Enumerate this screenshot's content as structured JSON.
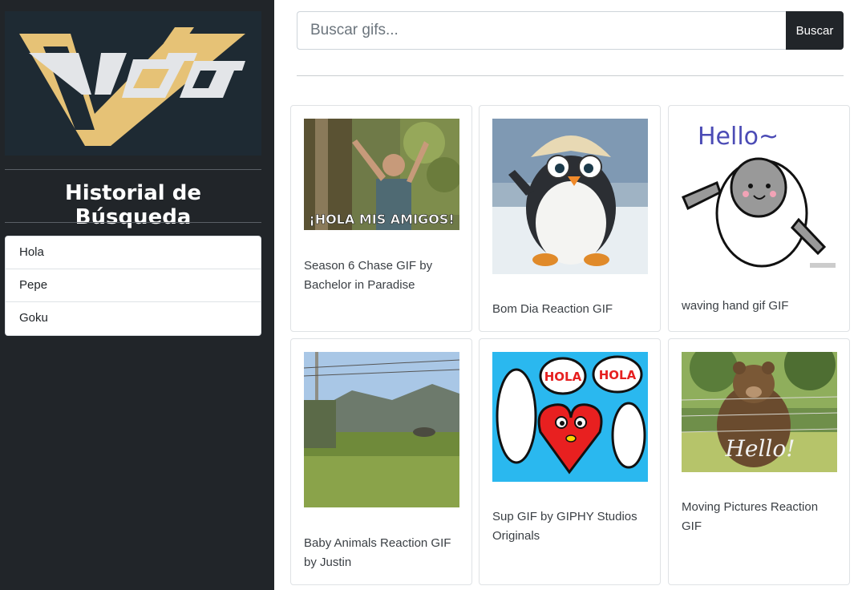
{
  "logo": {
    "name": "victor-logo",
    "colors": {
      "gold": "#e6c276",
      "silver": "#e3e5e8",
      "background": "#1e2a33"
    }
  },
  "sidebar": {
    "title": "Historial de Búsqueda",
    "history": [
      "Hola",
      "Pepe",
      "Goku"
    ]
  },
  "search": {
    "placeholder": "Buscar gifs...",
    "value": "",
    "button_label": "Buscar"
  },
  "results": [
    {
      "caption": "Season 6 Chase GIF by Bachelor in Paradise",
      "overlay_text": "¡HOLA MIS AMIGOS!"
    },
    {
      "caption": "Bom Dia Reaction GIF"
    },
    {
      "caption": "waving hand gif GIF",
      "overlay_text": "Hello~"
    },
    {
      "caption": "Baby Animals Reaction GIF by Justin"
    },
    {
      "caption": "Sup GIF by GIPHY Studios Originals",
      "overlay_text": "HOLA"
    },
    {
      "caption": "Moving Pictures Reaction GIF",
      "overlay_text": "Hello!"
    }
  ],
  "colors": {
    "sidebar_bg": "#212529",
    "button_bg": "#212529",
    "card_border": "#dfe2e5"
  }
}
